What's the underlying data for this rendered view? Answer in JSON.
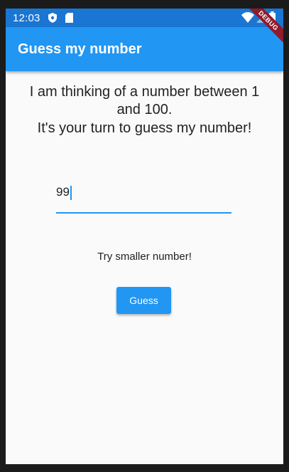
{
  "status_bar": {
    "time": "12:03",
    "icons": [
      "shield-icon",
      "sd-card-icon",
      "wifi-icon",
      "signal-icon",
      "battery-icon"
    ]
  },
  "app_bar": {
    "title": "Guess my number",
    "debug_banner": "DEBUG"
  },
  "main": {
    "intro_line_1": "I am thinking of a number between 1",
    "intro_line_2": "and 100.",
    "intro_line_3": "It's your turn to guess my number!",
    "guess_value": "99",
    "hint": "Try smaller number!",
    "guess_button_label": "Guess"
  },
  "colors": {
    "status_bar": "#1976d2",
    "app_bar": "#2196f3",
    "accent": "#2196f3",
    "background": "#fafafa",
    "debug_banner": "#8e1b2e"
  }
}
